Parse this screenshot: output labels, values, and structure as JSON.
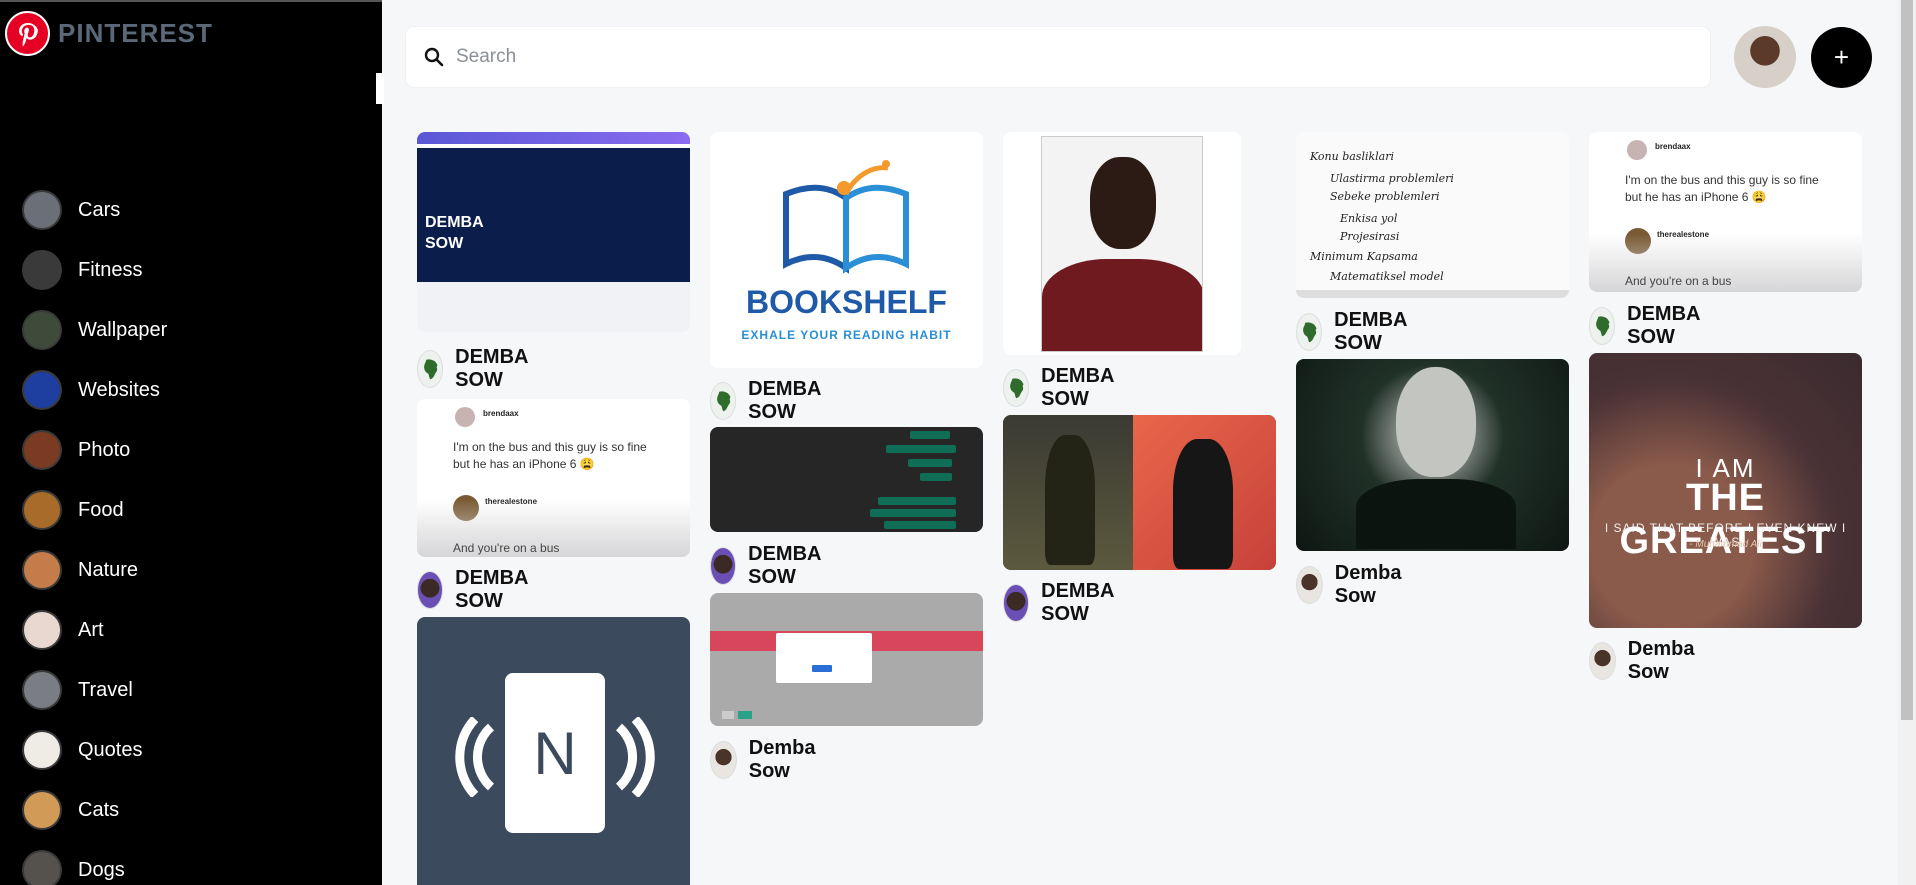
{
  "app": {
    "logo_text": "PINTEREST",
    "brand_color": "#e60023"
  },
  "sidebar": {
    "categories": [
      {
        "label": "Cars",
        "thumb": "#6b7078"
      },
      {
        "label": "Fitness",
        "thumb": "#3a3a3a"
      },
      {
        "label": "Wallpaper",
        "thumb": "#3f4b3a"
      },
      {
        "label": "Websites",
        "thumb": "#1e3ea0"
      },
      {
        "label": "Photo",
        "thumb": "#7a3b22"
      },
      {
        "label": "Food",
        "thumb": "#a86b2a"
      },
      {
        "label": "Nature",
        "thumb": "#c47c4a"
      },
      {
        "label": "Art",
        "thumb": "#e8d8d0"
      },
      {
        "label": "Travel",
        "thumb": "#7b7d84"
      },
      {
        "label": "Quotes",
        "thumb": "#efece6"
      },
      {
        "label": "Cats",
        "thumb": "#d19a56"
      },
      {
        "label": "Dogs",
        "thumb": "#55524e"
      }
    ]
  },
  "header": {
    "search_placeholder": "Search",
    "add_label": "+"
  },
  "pins": {
    "p1": {
      "img_text_1": "DEMBA",
      "img_text_2": "SOW",
      "author": "DEMBA SOW"
    },
    "p2": {
      "handle": "brendaax",
      "body": "I'm on the bus and this guy is so fine but he has an iPhone 6 😩",
      "handle2": "therealestone",
      "footer": "And you're on a bus",
      "author": "DEMBA SOW"
    },
    "p3": {
      "card_letter": "N"
    },
    "p4": {
      "logo_word": "BOOKSHELF",
      "tagline": "EXHALE YOUR READING HABIT",
      "author": "DEMBA SOW"
    },
    "p5": {
      "author": "DEMBA SOW"
    },
    "p6": {
      "author": "Demba Sow"
    },
    "p7": {
      "author": "DEMBA SOW"
    },
    "p8": {
      "author": "DEMBA SOW"
    },
    "p9": {
      "notes_title": "Konu basliklari",
      "notes_items": [
        "Ulastirma problemleri",
        "Sebeke problemleri",
        "Enkisa yol",
        "Projesirasi",
        "Minimum Kapsama",
        "Matematiksel model"
      ],
      "author": "DEMBA SOW"
    },
    "p10": {
      "author": "Demba Sow"
    },
    "p11": {
      "handle": "brendaax",
      "body": "I'm on the bus and this guy is so fine but he has an iPhone 6 😩",
      "handle2": "therealestone",
      "footer": "And you're on a bus",
      "author": "DEMBA SOW"
    },
    "p12": {
      "line1": "I AM",
      "line2": "THE GREATEST",
      "line3": "I SAID THAT BEFORE I EVEN KNEW I WAS",
      "line4": "- Muhammad Ali",
      "author": "Demba Sow"
    }
  }
}
